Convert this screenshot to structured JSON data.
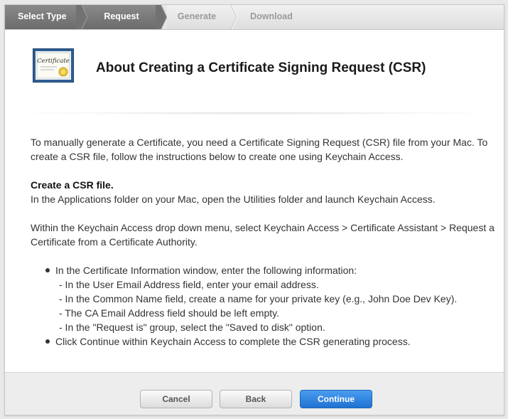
{
  "steps": [
    {
      "label": "Select Type",
      "state": "done"
    },
    {
      "label": "Request",
      "state": "current"
    },
    {
      "label": "Generate",
      "state": "todo"
    },
    {
      "label": "Download",
      "state": "todo"
    }
  ],
  "header": {
    "icon": "certificate-icon",
    "icon_text": "Certificate",
    "title": "About Creating a Certificate Signing Request (CSR)"
  },
  "content": {
    "intro": "To manually generate a Certificate, you need a Certificate Signing Request (CSR) file from your Mac. To create a CSR file, follow the instructions below to create one using Keychain Access.",
    "section_heading": "Create a CSR file.",
    "section_text": "In the Applications folder on your Mac, open the Utilities folder and launch Keychain Access.",
    "menu_instructions": "Within the Keychain Access drop down menu, select Keychain Access > Certificate Assistant > Request a Certificate from a Certificate Authority.",
    "bullets": [
      {
        "text": "In the Certificate Information window, enter the following information:",
        "sub": [
          "- In the User Email Address field, enter your email address.",
          "- In the Common Name field, create a name for your private key (e.g., John Doe Dev Key).",
          "- The CA Email Address field should be left empty.",
          "- In the \"Request is\" group, select the \"Saved to disk\" option."
        ]
      },
      {
        "text": "Click Continue within Keychain Access to complete the CSR generating process."
      }
    ]
  },
  "footer": {
    "cancel_label": "Cancel",
    "back_label": "Back",
    "continue_label": "Continue"
  },
  "colors": {
    "accent": "#2b7de0",
    "step_done": "#7a7a7a",
    "step_todo_text": "#9a9a9a"
  }
}
